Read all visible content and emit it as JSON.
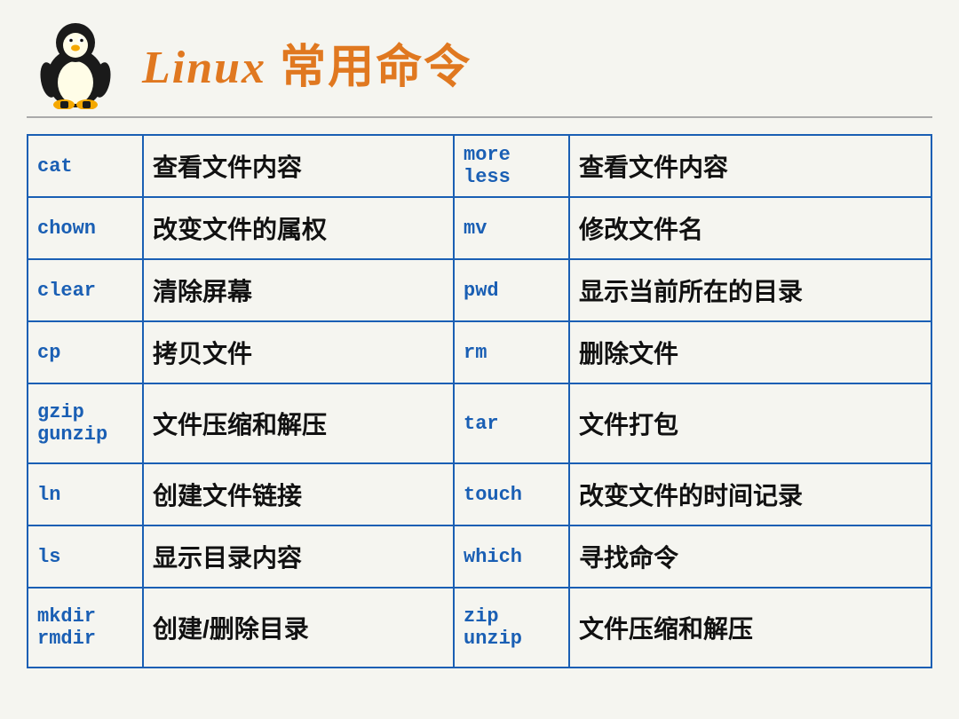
{
  "header": {
    "title_latin": "Linux",
    "title_chinese": " 常用命令"
  },
  "table": {
    "rows": [
      {
        "cmd_left": "cat",
        "desc_left": "查看文件内容",
        "cmd_right": "more\nless",
        "desc_right": "查看文件内容"
      },
      {
        "cmd_left": "chown",
        "desc_left": "改变文件的属权",
        "cmd_right": "mv",
        "desc_right": "修改文件名"
      },
      {
        "cmd_left": "clear",
        "desc_left": "清除屏幕",
        "cmd_right": "pwd",
        "desc_right": "显示当前所在的目录"
      },
      {
        "cmd_left": "cp",
        "desc_left": "拷贝文件",
        "cmd_right": "rm",
        "desc_right": "删除文件"
      },
      {
        "cmd_left": "gzip\ngunzip",
        "desc_left": "文件压缩和解压",
        "cmd_right": "tar",
        "desc_right": "文件打包"
      },
      {
        "cmd_left": "ln",
        "desc_left": "创建文件链接",
        "cmd_right": "touch",
        "desc_right": "改变文件的时间记录"
      },
      {
        "cmd_left": "ls",
        "desc_left": "显示目录内容",
        "cmd_right": "which",
        "desc_right": "寻找命令"
      },
      {
        "cmd_left": "mkdir\nrmdir",
        "desc_left": "创建/删除目录",
        "cmd_right": "zip\nunzip",
        "desc_right": "文件压缩和解压"
      }
    ]
  }
}
